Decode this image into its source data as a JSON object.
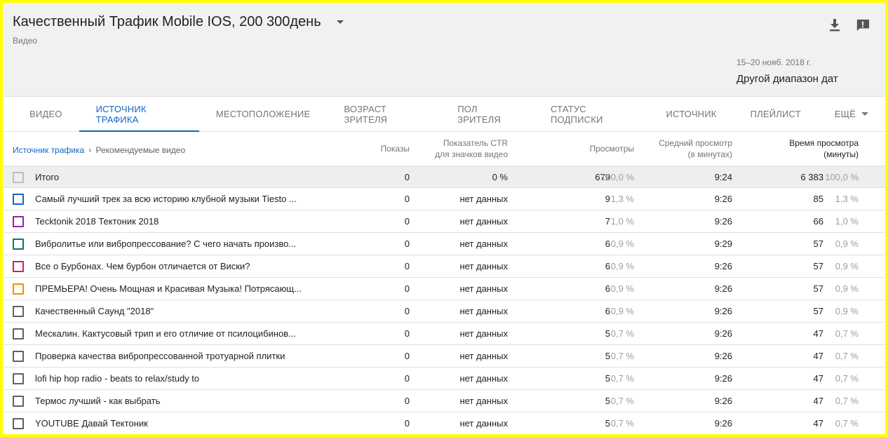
{
  "header": {
    "title": "Качественный Трафик Mobile IOS, 200 300день",
    "subtitle": "Видео",
    "date_range": "15–20 нояб. 2018 г.",
    "date_other": "Другой диапазон дат"
  },
  "icons": {
    "download": "download-icon",
    "feedback": "feedback-icon"
  },
  "tabs": [
    {
      "label": "ВИДЕО"
    },
    {
      "label": "ИСТОЧНИК ТРАФИКА"
    },
    {
      "label": "МЕСТОПОЛОЖЕНИЕ"
    },
    {
      "label": "ВОЗРАСТ ЗРИТЕЛЯ"
    },
    {
      "label": "ПОЛ ЗРИТЕЛЯ"
    },
    {
      "label": "СТАТУС ПОДПИСКИ"
    },
    {
      "label": "ИСТОЧНИК"
    },
    {
      "label": "ПЛЕЙЛИСТ"
    },
    {
      "label": "ЕЩЁ"
    }
  ],
  "breadcrumb": {
    "link": "Источник трафика",
    "sep": "›",
    "current": "Рекомендуемые видео"
  },
  "columns": {
    "impressions": "Показы",
    "ctr_1": "Показатель CTR",
    "ctr_2": "для значков видео",
    "views": "Просмотры",
    "avg_1": "Средний просмотр",
    "avg_2": "(в минутах)",
    "watch_1": "Время просмотра",
    "watch_2": "(минуты)"
  },
  "colors": {
    "accent": "#1565c0"
  },
  "total": {
    "name": "Итого",
    "impressions": "0",
    "ctr": "0 %",
    "views": "679",
    "views_pct": "100,0 %",
    "avg": "9:24",
    "watch": "6 383",
    "watch_pct": "100,0 %"
  },
  "rows": [
    {
      "color": "#1565c0",
      "name": "Самый лучший трек за всю историю клубной музыки Tiesto ...",
      "impressions": "0",
      "ctr": "нет данных",
      "views": "9",
      "views_pct": "1,3 %",
      "avg": "9:26",
      "watch": "85",
      "watch_pct": "1,3 %"
    },
    {
      "color": "#8e24aa",
      "name": "Tecktonik 2018 Тектоник 2018",
      "impressions": "0",
      "ctr": "нет данных",
      "views": "7",
      "views_pct": "1,0 %",
      "avg": "9:26",
      "watch": "66",
      "watch_pct": "1,0 %"
    },
    {
      "color": "#00796b",
      "name": "Вибролитье или вибропрессование? С чего начать произво...",
      "impressions": "0",
      "ctr": "нет данных",
      "views": "6",
      "views_pct": "0,9 %",
      "avg": "9:29",
      "watch": "57",
      "watch_pct": "0,9 %"
    },
    {
      "color": "#d81b60",
      "name": "Все о Бурбонах. Чем бурбон отличается от Виски?",
      "impressions": "0",
      "ctr": "нет данных",
      "views": "6",
      "views_pct": "0,9 %",
      "avg": "9:26",
      "watch": "57",
      "watch_pct": "0,9 %"
    },
    {
      "color": "#fb8c00",
      "name": "ПРЕМЬЕРА! Очень Мощная и Красивая Музыка! Потрясающ...",
      "impressions": "0",
      "ctr": "нет данных",
      "views": "6",
      "views_pct": "0,9 %",
      "avg": "9:26",
      "watch": "57",
      "watch_pct": "0,9 %"
    },
    {
      "color": "#616161",
      "name": "Качественный Саунд \"2018\"",
      "impressions": "0",
      "ctr": "нет данных",
      "views": "6",
      "views_pct": "0,9 %",
      "avg": "9:26",
      "watch": "57",
      "watch_pct": "0,9 %"
    },
    {
      "color": "#616161",
      "name": "Мескалин. Кактусовый трип и его отличие от псилоцибинов...",
      "impressions": "0",
      "ctr": "нет данных",
      "views": "5",
      "views_pct": "0,7 %",
      "avg": "9:26",
      "watch": "47",
      "watch_pct": "0,7 %"
    },
    {
      "color": "#616161",
      "name": "Проверка качества вибропрессованной тротуарной плитки",
      "impressions": "0",
      "ctr": "нет данных",
      "views": "5",
      "views_pct": "0,7 %",
      "avg": "9:26",
      "watch": "47",
      "watch_pct": "0,7 %"
    },
    {
      "color": "#616161",
      "name": "lofi hip hop radio - beats to relax/study to",
      "impressions": "0",
      "ctr": "нет данных",
      "views": "5",
      "views_pct": "0,7 %",
      "avg": "9:26",
      "watch": "47",
      "watch_pct": "0,7 %"
    },
    {
      "color": "#616161",
      "name": "Термос лучший - как выбрать",
      "impressions": "0",
      "ctr": "нет данных",
      "views": "5",
      "views_pct": "0,7 %",
      "avg": "9:26",
      "watch": "47",
      "watch_pct": "0,7 %"
    },
    {
      "color": "#616161",
      "name": "YOUTUBE Давай Тектоник",
      "impressions": "0",
      "ctr": "нет данных",
      "views": "5",
      "views_pct": "0,7 %",
      "avg": "9:26",
      "watch": "47",
      "watch_pct": "0,7 %"
    }
  ]
}
